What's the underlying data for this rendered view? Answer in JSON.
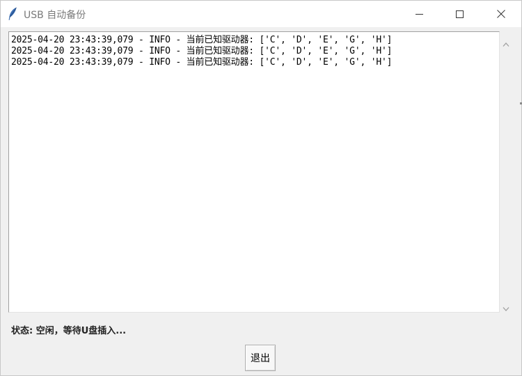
{
  "window": {
    "title": "USB 自动备份",
    "icon": "feather-icon"
  },
  "log": {
    "lines": [
      "2025-04-20 23:43:39,079 - INFO - 当前已知驱动器: ['C', 'D', 'E', 'G', 'H']",
      "2025-04-20 23:43:39,079 - INFO - 当前已知驱动器: ['C', 'D', 'E', 'G', 'H']",
      "2025-04-20 23:43:39,079 - INFO - 当前已知驱动器: ['C', 'D', 'E', 'G', 'H']"
    ]
  },
  "status": {
    "text": "状态: 空闲，等待U盘插入..."
  },
  "buttons": {
    "exit_label": "退出"
  },
  "colors": {
    "titlebar_bg": "#ffffff",
    "window_bg": "#f0f0f0",
    "title_text": "#7a7a7a"
  }
}
